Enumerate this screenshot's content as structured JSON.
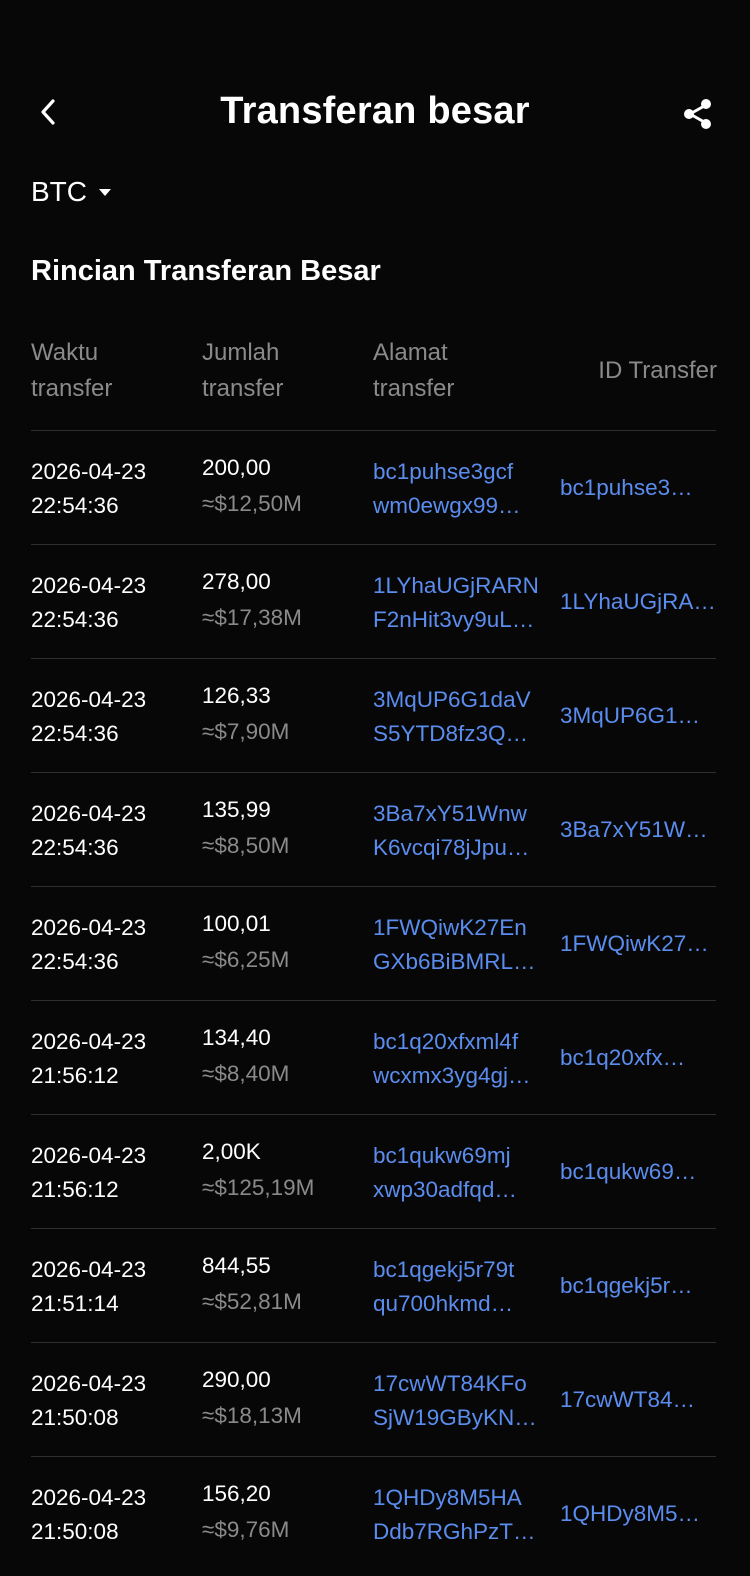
{
  "header": {
    "title": "Transferan besar",
    "back_icon": "chevron-left-icon",
    "share_icon": "share-icon"
  },
  "coin_selector": {
    "value": "BTC"
  },
  "section": {
    "title": "Rincian Transferan Besar"
  },
  "table": {
    "headers": {
      "time": "Waktu\ntransfer",
      "amount": "Jumlah\ntransfer",
      "address": "Alamat\ntransfer",
      "id": "ID Transfer"
    },
    "rows": [
      {
        "date": "2026-04-23",
        "time": "22:54:36",
        "amount": "200,00",
        "usd": "≈$12,50M",
        "addr1": "bc1puhse3gcf",
        "addr2": "wm0ewgx99…",
        "txid": "bc1puhse3…"
      },
      {
        "date": "2026-04-23",
        "time": "22:54:36",
        "amount": "278,00",
        "usd": "≈$17,38M",
        "addr1": "1LYhaUGjRARN",
        "addr2": "F2nHit3vy9uL…",
        "txid": "1LYhaUGjRA…"
      },
      {
        "date": "2026-04-23",
        "time": "22:54:36",
        "amount": "126,33",
        "usd": "≈$7,90M",
        "addr1": "3MqUP6G1daV",
        "addr2": "S5YTD8fz3Q…",
        "txid": "3MqUP6G1…"
      },
      {
        "date": "2026-04-23",
        "time": "22:54:36",
        "amount": "135,99",
        "usd": "≈$8,50M",
        "addr1": "3Ba7xY51Wnw",
        "addr2": "K6vcqi78jJpu…",
        "txid": "3Ba7xY51W…"
      },
      {
        "date": "2026-04-23",
        "time": "22:54:36",
        "amount": "100,01",
        "usd": "≈$6,25M",
        "addr1": "1FWQiwK27En",
        "addr2": "GXb6BiBMRL…",
        "txid": "1FWQiwK27…"
      },
      {
        "date": "2026-04-23",
        "time": "21:56:12",
        "amount": "134,40",
        "usd": "≈$8,40M",
        "addr1": "bc1q20xfxml4f",
        "addr2": "wcxmx3yg4gj…",
        "txid": "bc1q20xfx…"
      },
      {
        "date": "2026-04-23",
        "time": "21:56:12",
        "amount": "2,00K",
        "usd": "≈$125,19M",
        "addr1": "bc1qukw69mj",
        "addr2": "xwp30adfqd…",
        "txid": "bc1qukw69…"
      },
      {
        "date": "2026-04-23",
        "time": "21:51:14",
        "amount": "844,55",
        "usd": "≈$52,81M",
        "addr1": "bc1qgekj5r79t",
        "addr2": "qu700hkmd…",
        "txid": "bc1qgekj5r…"
      },
      {
        "date": "2026-04-23",
        "time": "21:50:08",
        "amount": "290,00",
        "usd": "≈$18,13M",
        "addr1": "17cwWT84KFo",
        "addr2": "SjW19GByKN…",
        "txid": "17cwWT84…"
      },
      {
        "date": "2026-04-23",
        "time": "21:50:08",
        "amount": "156,20",
        "usd": "≈$9,76M",
        "addr1": "1QHDy8M5HA",
        "addr2": "Ddb7RGhPzT…",
        "txid": "1QHDy8M5…"
      }
    ]
  },
  "colors": {
    "background": "#070707",
    "link": "#5b8def",
    "muted": "#8a8a8a",
    "divider": "#2e2e2e"
  }
}
